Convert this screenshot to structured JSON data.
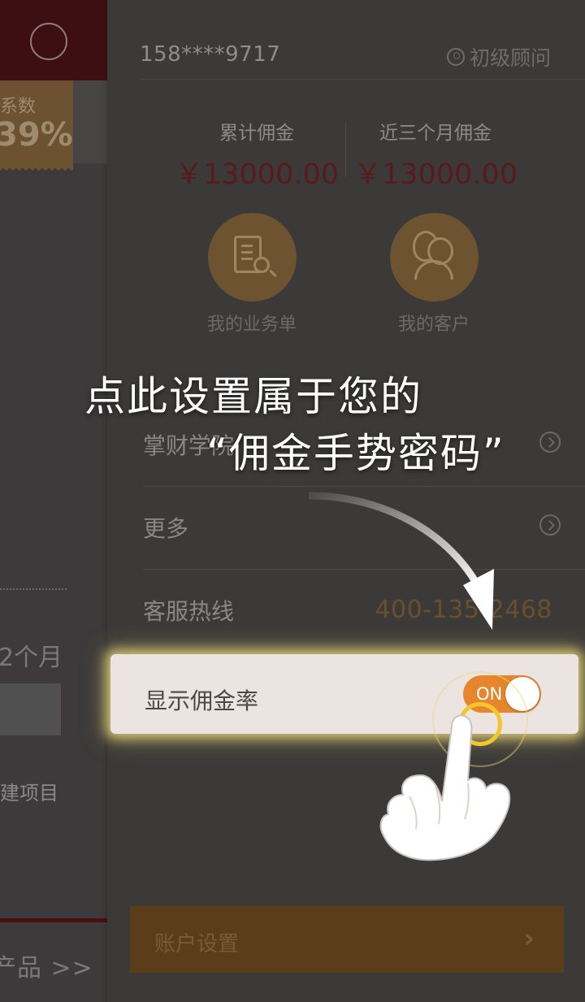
{
  "left_page": {
    "ticket_label": "系数",
    "ticket_value": "39%",
    "month_text": "2个月",
    "project_text": "建项目",
    "products_link": "产品 >>"
  },
  "drawer": {
    "phone": "158****9717",
    "level": "初级顾问",
    "stats": {
      "total_label": "累计佣金",
      "total_value": "￥13000.00",
      "recent_label": "近三个月佣金",
      "recent_value": "￥13000.00"
    },
    "quick_links": {
      "orders_label": "我的业务单",
      "customers_label": "我的客户"
    },
    "menu": {
      "academy_label": "掌财学院",
      "more_label": "更多",
      "hotline_label": "客服热线",
      "hotline_number": "400-135-2468"
    },
    "commission_row": {
      "label": "显示佣金率",
      "toggle_state": "ON"
    },
    "account_button": {
      "label": "账户设置",
      "chevron": "›"
    }
  },
  "tutorial": {
    "line1": "点此设置属于您的",
    "line2": "“佣金手势密码”"
  },
  "colors": {
    "accent_orange": "#e6862c",
    "highlight_glow": "#f2c72e",
    "commission_red": "#5a1a1d"
  }
}
